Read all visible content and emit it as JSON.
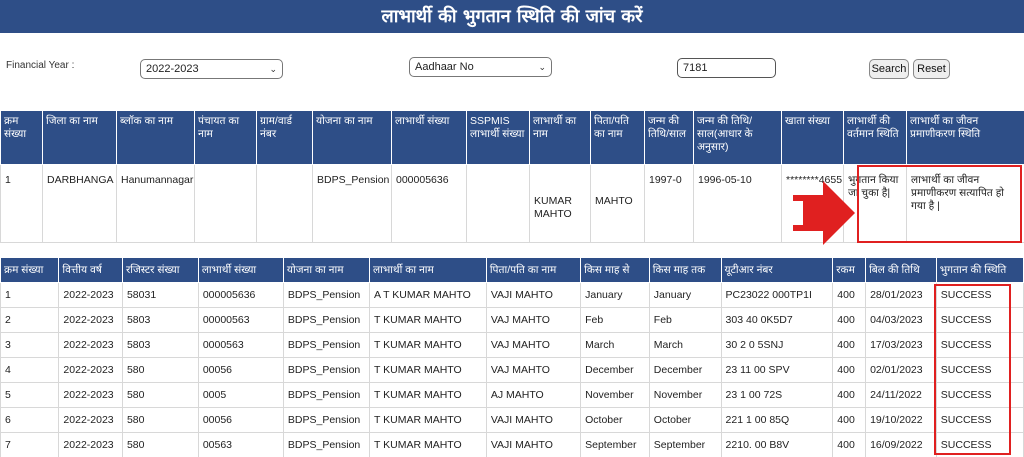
{
  "page": {
    "title": "लाभार्थी की भुगतान स्थिति की जांच करें"
  },
  "filters": {
    "financial_year_label": "Financial Year :",
    "financial_year_value": "2022-2023",
    "id_type_value": "Aadhaar No",
    "id_input_value": "7181",
    "search_label": "Search",
    "reset_label": "Reset"
  },
  "beneficiary_table": {
    "headers": [
      "क्रम संख्या",
      "जिला का नाम",
      "ब्लॉक का नाम",
      "पंचायत का नाम",
      "ग्राम/वार्ड नंबर",
      "योजना का नाम",
      "लाभार्थी संख्या",
      "SSPMIS लाभार्थी संख्या",
      "लाभार्थी का नाम",
      "पिता/पति का नाम",
      "जन्म की तिथि/साल",
      "जन्म की तिथि/साल(आधार के अनुसार)",
      "खाता संख्या",
      "लाभार्थी की वर्तमान स्थिति",
      "लाभार्थी का जीवन प्रमाणीकरण स्थिति"
    ],
    "row": [
      "1",
      "DARBHANGA",
      "Hanumannagar",
      "",
      "",
      "BDPS_Pension",
      "000005636",
      "",
      "KUMAR MAHTO",
      "MAHTO",
      "1997-0",
      "1996-05-10",
      "********4655",
      "भुगतान किया जा चुका है|",
      "लाभार्थी का जीवन प्रमाणीकरण सत्यापित हो गया है |"
    ]
  },
  "payment_table": {
    "headers": [
      "क्रम संख्या",
      "वित्तीय वर्ष",
      "रजिस्टर संख्या",
      "लाभार्थी संख्या",
      "योजना का नाम",
      "लाभार्थी का नाम",
      "पिता/पति का नाम",
      "किस माह से",
      "किस माह तक",
      "यूटीआर नंबर",
      "रकम",
      "बिल की तिथि",
      "भुगतान की स्थिति"
    ],
    "rows": [
      [
        "1",
        "2022-2023",
        "58031",
        "000005636",
        "BDPS_Pension",
        "A T KUMAR MAHTO",
        "VAJI MAHTO",
        "January",
        "January",
        "PC23022 000TP1I",
        "400",
        "28/01/2023",
        "SUCCESS"
      ],
      [
        "2",
        "2022-2023",
        "5803",
        "00000563",
        "BDPS_Pension",
        "T KUMAR MAHTO",
        "VAJ MAHTO",
        "Feb",
        "Feb",
        "303 40 0K5D7",
        "400",
        "04/03/2023",
        "SUCCESS"
      ],
      [
        "3",
        "2022-2023",
        "5803",
        "0000563",
        "BDPS_Pension",
        "T KUMAR MAHTO",
        "VAJ MAHTO",
        "March",
        "March",
        "30 2 0 5SNJ",
        "400",
        "17/03/2023",
        "SUCCESS"
      ],
      [
        "4",
        "2022-2023",
        "580",
        "00056",
        "BDPS_Pension",
        "T KUMAR MAHTO",
        "VAJ MAHTO",
        "December",
        "December",
        "23 11 00 SPV",
        "400",
        "02/01/2023",
        "SUCCESS"
      ],
      [
        "5",
        "2022-2023",
        "580",
        "0005",
        "BDPS_Pension",
        "T KUMAR MAHTO",
        "AJ MAHTO",
        "November",
        "November",
        "23 1 00 72S",
        "400",
        "24/11/2022",
        "SUCCESS"
      ],
      [
        "6",
        "2022-2023",
        "580",
        "00056",
        "BDPS_Pension",
        "T KUMAR MAHTO",
        "VAJI MAHTO",
        "October",
        "October",
        "221 1 00 85Q",
        "400",
        "19/10/2022",
        "SUCCESS"
      ],
      [
        "7",
        "2022-2023",
        "580",
        "00563",
        "BDPS_Pension",
        "T KUMAR MAHTO",
        "VAJI MAHTO",
        "September",
        "September",
        "2210. 00 B8V",
        "400",
        "16/09/2022",
        "SUCCESS"
      ]
    ]
  },
  "colors": {
    "header_bg": "#2e4e87",
    "highlight": "#e02020"
  }
}
